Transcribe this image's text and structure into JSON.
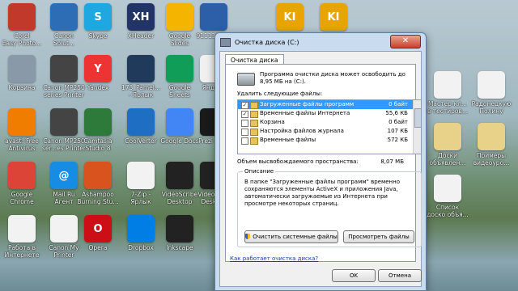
{
  "desktop": {
    "icons": [
      {
        "label": "Corel\nEasy Photo...",
        "color": "#c0392b",
        "glyph": "",
        "pos": "c0r0"
      },
      {
        "label": "Canon\nSolut...",
        "color": "#2d6db5",
        "glyph": "",
        "pos": "c1r0"
      },
      {
        "label": "Skype",
        "color": "#1ea7e1",
        "glyph": "S",
        "pos": "c2r0"
      },
      {
        "label": "XHeader",
        "color": "#223366",
        "glyph": "XH",
        "pos": "c3r0"
      },
      {
        "label": "Google\nSlides",
        "color": "#f4b400",
        "glyph": "",
        "pos": "c4r0"
      },
      {
        "label": "911111199",
        "color": "#2c5fa8",
        "glyph": "",
        "pos": "c5r0"
      },
      {
        "label": "Samsung Kies",
        "color": "#e8a400",
        "glyph": "KI",
        "pos": "c6r0"
      },
      {
        "label": "Samsung Kies",
        "color": "#e8a400",
        "glyph": "KI",
        "pos": "c7r0"
      },
      {
        "label": "Корзина",
        "color": "#8a99a8",
        "glyph": "",
        "pos": "c0r1"
      },
      {
        "label": "Canon MP250\nseries Printer",
        "color": "#444",
        "glyph": "",
        "pos": "c1r1"
      },
      {
        "label": "Yandex",
        "color": "#e33",
        "glyph": "Y",
        "pos": "c2r1"
      },
      {
        "label": "173_Pamel...\n- Ярлык",
        "color": "#1f3a5a",
        "glyph": "",
        "pos": "c3r1"
      },
      {
        "label": "Google\nSheets",
        "color": "#0f9d58",
        "glyph": "",
        "pos": "c4r1"
      },
      {
        "label": "Яндекс",
        "color": "#f0f0f0",
        "glyph": "",
        "pos": "c5r1"
      },
      {
        "label": "avast! Free\nAntivirus",
        "color": "#f07c00",
        "glyph": "",
        "pos": "c0r2"
      },
      {
        "label": "Canon MP250\nser...es Printer",
        "color": "#444",
        "glyph": "",
        "pos": "c1r2"
      },
      {
        "label": "Camtasia\nStudio 8",
        "color": "#2d7a3a",
        "glyph": "",
        "pos": "c2r2"
      },
      {
        "label": "CoolVerter",
        "color": "#1e6fc3",
        "glyph": "",
        "pos": "c3r2"
      },
      {
        "label": "Google Docs",
        "color": "#4285f4",
        "glyph": "",
        "pos": "c4r2"
      },
      {
        "label": "Prezi De...",
        "color": "#1a1a1a",
        "glyph": "",
        "pos": "c5r2"
      },
      {
        "label": "Google\nChrome",
        "color": "#db4437",
        "glyph": "",
        "pos": "c0r3"
      },
      {
        "label": "Mail.Ru\nАгент",
        "color": "#168de2",
        "glyph": "@",
        "pos": "c1r3"
      },
      {
        "label": "Ashampoo\nBurning Stu...",
        "color": "#d9531e",
        "glyph": "",
        "pos": "c2r3"
      },
      {
        "label": "7-Zip -\nЯрлык",
        "color": "#f2f2f2",
        "glyph": "",
        "pos": "c3r3"
      },
      {
        "label": "VideoScribe\nDesktop",
        "color": "#222",
        "glyph": "",
        "pos": "c4r3"
      },
      {
        "label": "VideoScr...\nDesktop",
        "color": "#222",
        "glyph": "",
        "pos": "c5r3"
      },
      {
        "label": "Работа в\nИнтернете",
        "color": "#f2f2f2",
        "glyph": "",
        "pos": "c0r4"
      },
      {
        "label": "Canon My\nPrinter",
        "color": "#f2f2f2",
        "glyph": "",
        "pos": "c1r4"
      },
      {
        "label": "Opera",
        "color": "#cc0f16",
        "glyph": "O",
        "pos": "c2r4"
      },
      {
        "label": "Dropbox",
        "color": "#007ee5",
        "glyph": "",
        "pos": "c3r4"
      },
      {
        "label": "Inkscape",
        "color": "#222",
        "glyph": "",
        "pos": "c4r4"
      },
      {
        "label": "Мастер-кл...\nв тестиров...",
        "color": "#f2f2f2",
        "glyph": "",
        "pos": "right0"
      },
      {
        "label": "Радонецкую\nПолину",
        "color": "#f2f2f2",
        "glyph": "",
        "pos": "right1"
      },
      {
        "label": "Доски\nобъявлен...",
        "color": "#e8d28a",
        "glyph": "",
        "pos": "right2"
      },
      {
        "label": "Примеры\nвидеоуро...",
        "color": "#e8d28a",
        "glyph": "",
        "pos": "right3"
      },
      {
        "label": "Список\nдоско объя...",
        "color": "#f2f2f2",
        "glyph": "",
        "pos": "right4"
      }
    ]
  },
  "dialog": {
    "window_title": "Очистка диска (C:)",
    "close_label": "✕",
    "tab_label": "Очистка диска",
    "summary": "Программа очистки диска может освободить до 8,95 МБ на (C:).",
    "delete_label": "Удалить следующие файлы:",
    "files": [
      {
        "name": "Загруженные файлы программ",
        "size": "0 байт",
        "checked": true,
        "selected": true
      },
      {
        "name": "Временные файлы Интернета",
        "size": "55,6 КБ",
        "checked": true,
        "selected": false
      },
      {
        "name": "Корзина",
        "size": "0 байт",
        "checked": false,
        "selected": false
      },
      {
        "name": "Настройка файлов журнала",
        "size": "107 КБ",
        "checked": false,
        "selected": false
      },
      {
        "name": "Временные файлы",
        "size": "572 КБ",
        "checked": false,
        "selected": false
      }
    ],
    "total_label": "Объем высвобождаемого пространства:",
    "total_value": "8,07 МБ",
    "desc_title": "Описание",
    "description": "В папке \"Загруженные файлы программ\" временно сохраняются элементы ActiveX и приложения Java, автоматически загружаемые из Интернета при просмотре некоторых страниц.",
    "system_button": "Очистить системные файлы",
    "view_button": "Просмотреть файлы",
    "help_link": "Как работает очистка диска?",
    "ok_button": "OK",
    "cancel_button": "Отмена"
  }
}
